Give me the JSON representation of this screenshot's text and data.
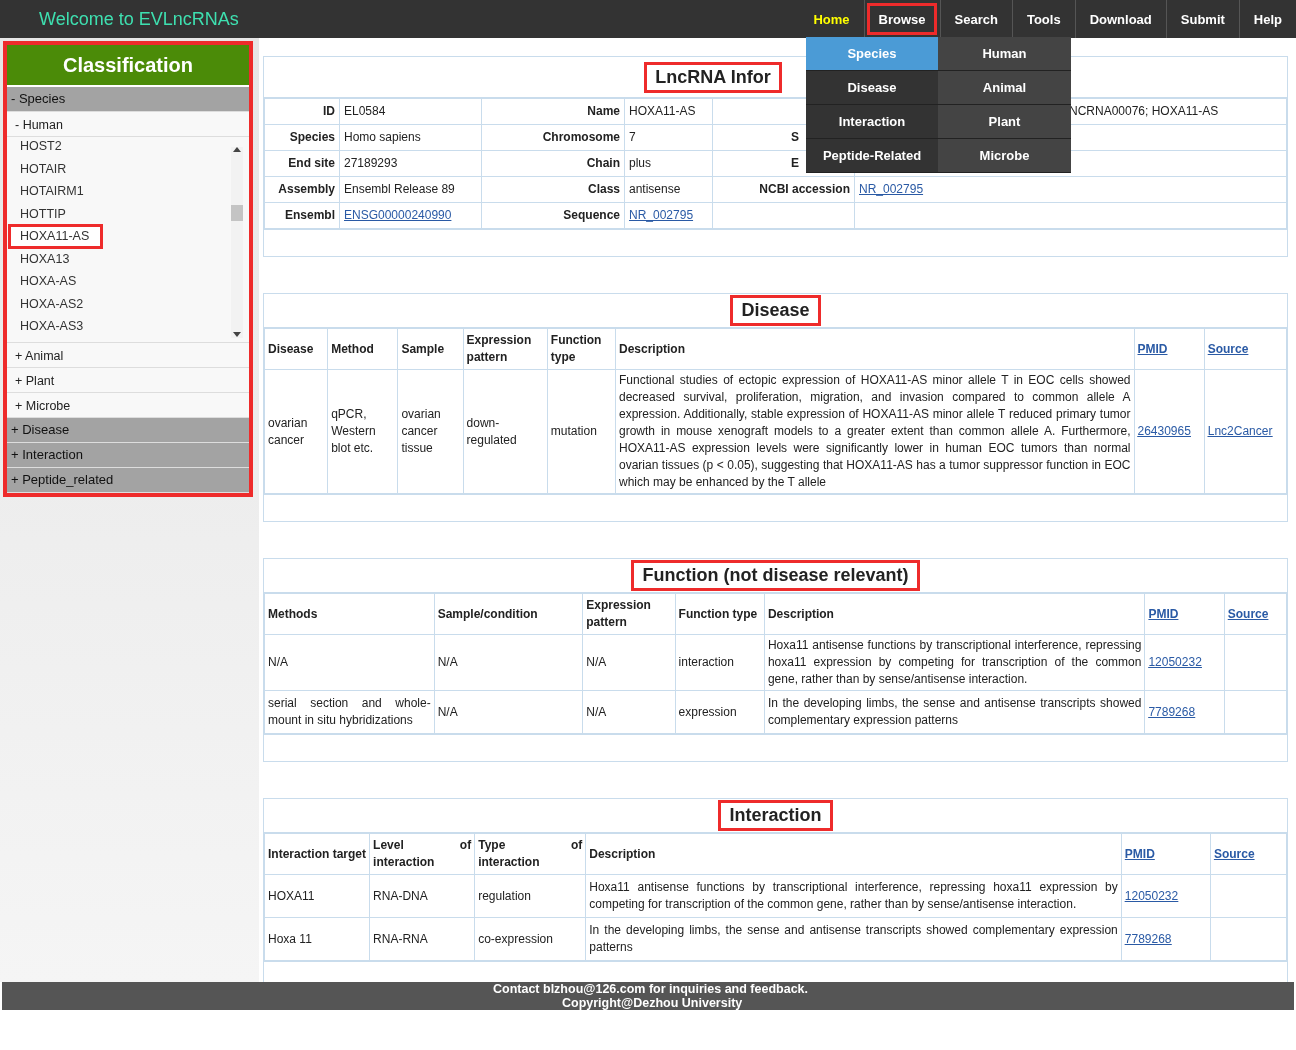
{
  "header": {
    "title": "Welcome to EVLncRNAs"
  },
  "nav": [
    {
      "label": "Home",
      "selected": true,
      "highlighted": false
    },
    {
      "label": "Browse",
      "selected": false,
      "highlighted": true
    },
    {
      "label": "Search",
      "selected": false,
      "highlighted": false
    },
    {
      "label": "Tools",
      "selected": false,
      "highlighted": false
    },
    {
      "label": "Download",
      "selected": false,
      "highlighted": false
    },
    {
      "label": "Submit",
      "selected": false,
      "highlighted": false
    },
    {
      "label": "Help",
      "selected": false,
      "highlighted": false
    }
  ],
  "browse_menu": {
    "categories": [
      {
        "label": "Species",
        "selected": true
      },
      {
        "label": "Disease",
        "selected": false
      },
      {
        "label": "Interaction",
        "selected": false
      },
      {
        "label": "Peptide-Related",
        "selected": false
      }
    ],
    "items": [
      {
        "label": "Human"
      },
      {
        "label": "Animal"
      },
      {
        "label": "Plant"
      },
      {
        "label": "Microbe"
      }
    ]
  },
  "sidebar": {
    "title": "Classification",
    "highlighted": true,
    "groups": [
      {
        "label": "- Species",
        "children": [
          {
            "label": "- Human",
            "children": [
              {
                "label": "HOST2",
                "highlighted": false
              },
              {
                "label": "HOTAIR",
                "highlighted": false
              },
              {
                "label": "HOTAIRM1",
                "highlighted": false
              },
              {
                "label": "HOTTIP",
                "highlighted": false
              },
              {
                "label": "HOXA11-AS",
                "highlighted": true
              },
              {
                "label": "HOXA13",
                "highlighted": false
              },
              {
                "label": "HOXA-AS",
                "highlighted": false
              },
              {
                "label": "HOXA-AS2",
                "highlighted": false
              },
              {
                "label": "HOXA-AS3",
                "highlighted": false
              }
            ]
          },
          {
            "label": "+ Animal"
          },
          {
            "label": "+ Plant"
          },
          {
            "label": "+ Microbe"
          }
        ]
      },
      {
        "label": "+ Disease"
      },
      {
        "label": "+ Interaction"
      },
      {
        "label": "+ Peptide_related"
      }
    ]
  },
  "sections": [
    {
      "kind": "info",
      "title": "LncRNA Infor",
      "highlighted": true,
      "rows": [
        [
          {
            "label": "ID",
            "value": "EL0584"
          },
          {
            "label": "Name",
            "value": "HOXA11-AS"
          },
          {
            "value": "NCRNA00076; HOXA11-AS"
          }
        ],
        [
          {
            "label": "Species",
            "value": "Homo sapiens"
          },
          {
            "label": "Chromosome",
            "value": "7"
          },
          {
            "label": "S"
          }
        ],
        [
          {
            "label": "End site",
            "value": "27189293"
          },
          {
            "label": "Chain",
            "value": "plus"
          },
          {
            "label": "E"
          }
        ],
        [
          {
            "label": "Assembly",
            "value": "Ensembl Release 89"
          },
          {
            "label": "Class",
            "value": "antisense"
          },
          {
            "label": "NCBI accession",
            "value": "NR_002795",
            "link": true
          }
        ],
        [
          {
            "label": "Ensembl",
            "value": "ENSG00000240990",
            "link": true
          },
          {
            "label": "Sequence",
            "value": "NR_002795",
            "link": true
          },
          {}
        ]
      ]
    },
    {
      "kind": "table",
      "title": "Disease",
      "highlighted": true,
      "columns": [
        {
          "label": "Disease",
          "kind": "text"
        },
        {
          "label": "Method",
          "kind": "text"
        },
        {
          "label": "Sample",
          "kind": "text"
        },
        {
          "label": "Expression pattern",
          "kind": "text"
        },
        {
          "label": "Function type",
          "kind": "text"
        },
        {
          "label": "Description",
          "kind": "desc"
        },
        {
          "label": "PMID",
          "kind": "link"
        },
        {
          "label": "Source",
          "kind": "link"
        }
      ],
      "rows": [
        [
          "ovarian cancer",
          "qPCR, Western blot etc.",
          "ovarian cancer tissue",
          "down-regulated",
          "mutation",
          "Functional studies of ectopic expression of HOXA11-AS minor allele T in EOC cells showed decreased survival, proliferation, migration, and invasion compared to common allele A expression. Additionally, stable expression of HOXA11-AS minor allele T reduced primary tumor growth in mouse xenograft models to a greater extent than common allele A. Furthermore, HOXA11-AS expression levels were significantly lower in human EOC tumors than normal ovarian tissues (p < 0.05), suggesting that HOXA11-AS has a tumor suppressor function in EOC which may be enhanced by the T allele",
          "26430965",
          "Lnc2Cancer"
        ]
      ]
    },
    {
      "kind": "table",
      "title": "Function (not disease relevant)",
      "highlighted": true,
      "columns": [
        {
          "label": "Methods",
          "kind": "desc"
        },
        {
          "label": "Sample/condition",
          "kind": "text"
        },
        {
          "label": "Expression pattern",
          "kind": "text"
        },
        {
          "label": "Function type",
          "kind": "text"
        },
        {
          "label": "Description",
          "kind": "desc"
        },
        {
          "label": "PMID",
          "kind": "link"
        },
        {
          "label": "Source",
          "kind": "link"
        }
      ],
      "rows": [
        [
          "N/A",
          "N/A",
          "N/A",
          "interaction",
          "Hoxa11 antisense functions by transcriptional interference, repressing hoxa11 expression by competing for transcription of the common gene, rather than by sense/antisense interaction.",
          "12050232",
          ""
        ],
        [
          "serial section and whole-mount in situ hybridizations",
          "N/A",
          "N/A",
          "expression",
          "In the developing limbs, the sense and antisense transcripts showed complementary expression patterns",
          "7789268",
          ""
        ]
      ]
    },
    {
      "kind": "table",
      "title": "Interaction",
      "highlighted": true,
      "columns": [
        {
          "label": "Interaction target",
          "kind": "text"
        },
        {
          "label": "Level of interaction",
          "kind": "desc"
        },
        {
          "label": "Type of interaction",
          "kind": "desc"
        },
        {
          "label": "Description",
          "kind": "desc"
        },
        {
          "label": "PMID",
          "kind": "link"
        },
        {
          "label": "Source",
          "kind": "link"
        }
      ],
      "rows": [
        [
          "HOXA11",
          "RNA-DNA",
          "regulation",
          "Hoxa11 antisense functions by transcriptional interference, repressing hoxa11 expression by competing for transcription of the common gene, rather than by sense/antisense interaction.",
          "12050232",
          ""
        ],
        [
          "Hoxa 11",
          "RNA-RNA",
          "co-expression",
          "In the developing limbs, the sense and antisense transcripts showed complementary expression patterns",
          "7789268",
          ""
        ]
      ]
    }
  ],
  "footer": {
    "lines": [
      "Contact blzhou@126.com for inquiries and feedback.",
      "Copyright@Dezhou University"
    ]
  }
}
